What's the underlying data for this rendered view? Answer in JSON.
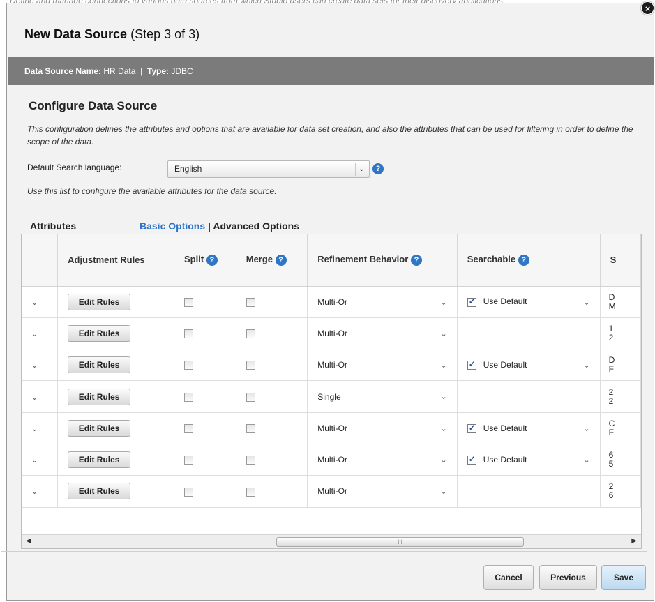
{
  "background_text": "Define and manage connections to various data sources from which Studio users can create data sets for their discovery applications.",
  "dialog": {
    "title": "New Data Source",
    "step": "(Step 3 of 3)",
    "close_glyph": "×"
  },
  "infobar": {
    "name_label": "Data Source Name:",
    "name_value": "HR Data",
    "separator": "|",
    "type_label": "Type:",
    "type_value": "JDBC"
  },
  "configure": {
    "title": "Configure Data Source",
    "description": "This configuration defines the attributes and options that are available for data set creation, and also the attributes that can be used for filtering in order to define the scope of the data.",
    "language_label": "Default Search language:",
    "language_value": "English",
    "hint": "Use this list to configure the available attributes for the data source."
  },
  "attributes_section": {
    "label": "Attributes",
    "basic_options": "Basic Options",
    "separator": "|",
    "advanced_options": "Advanced Options"
  },
  "table": {
    "headers": {
      "adjustment_rules": "Adjustment Rules",
      "split": "Split",
      "merge": "Merge",
      "refinement_behavior": "Refinement Behavior",
      "searchable": "Searchable",
      "cut": "S"
    },
    "edit_label": "Edit Rules",
    "rows": [
      {
        "refinement": "Multi-Or",
        "searchable": "Use Default",
        "searchable_checked": true,
        "cut": [
          "D",
          "M"
        ]
      },
      {
        "refinement": "Multi-Or",
        "searchable": "",
        "searchable_checked": false,
        "cut": [
          "1",
          "2"
        ]
      },
      {
        "refinement": "Multi-Or",
        "searchable": "Use Default",
        "searchable_checked": true,
        "cut": [
          "D",
          "F"
        ]
      },
      {
        "refinement": "Single",
        "searchable": "",
        "searchable_checked": false,
        "cut": [
          "2",
          "2"
        ]
      },
      {
        "refinement": "Multi-Or",
        "searchable": "Use Default",
        "searchable_checked": true,
        "cut": [
          "C",
          "F"
        ]
      },
      {
        "refinement": "Multi-Or",
        "searchable": "Use Default",
        "searchable_checked": true,
        "cut": [
          "6",
          "5"
        ]
      },
      {
        "refinement": "Multi-Or",
        "searchable": "",
        "searchable_checked": false,
        "cut": [
          "2",
          "6"
        ]
      }
    ]
  },
  "scrollbar": {
    "thumb_glyph": "III"
  },
  "footer": {
    "cancel": "Cancel",
    "previous": "Previous",
    "save": "Save"
  },
  "icons": {
    "help": "?",
    "dropdown": "⌄",
    "row_expand": "⌄"
  },
  "colors": {
    "infobar": "#7b7b7b",
    "link": "#2b72c8",
    "help_icon": "#2f76c4",
    "save_button": "#bcd9ef"
  }
}
